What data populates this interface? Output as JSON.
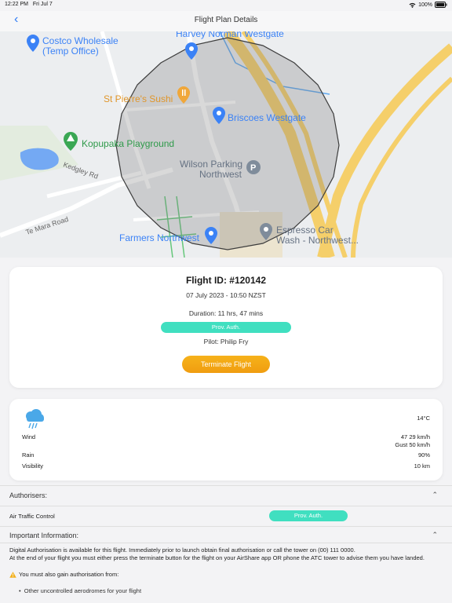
{
  "status_bar": {
    "time": "12:22 PM",
    "date": "Fri Jul 7",
    "battery": "100%"
  },
  "nav": {
    "back_icon": "chevron-left-icon",
    "title": "Flight Plan Details"
  },
  "map": {
    "labels": {
      "costco_1": "Costco Wholesale",
      "costco_2": "(Temp Office)",
      "harvey": "Harvey Norman Westgate",
      "sushi": "St Pierre's Sushi",
      "briscoes": "Briscoes Westgate",
      "kopupaka": "Kopupaka Playground",
      "kedgley": "Kedgley Rd",
      "wilson_1": "Wilson Parking",
      "wilson_2": "Northwest",
      "te_mara": "Te Mara Road",
      "farmers": "Farmers Northwest",
      "espresso_1": "Espresso Car",
      "espresso_2": "Wash - Northwest..."
    }
  },
  "flight": {
    "id": "Flight ID: #120142",
    "date": "07 July 2023 - 10:50 NZST",
    "duration": "Duration: 11 hrs, 47 mins",
    "status": "Prov. Auth.",
    "pilot": "Pilot: Philip Fry",
    "terminate_label": "Terminate Flight"
  },
  "weather": {
    "icon": "rain-cloud-icon",
    "temperature": "14°C",
    "wind_label": "Wind",
    "wind_speed": "47 29 km/h",
    "wind_gust": "Gust 50 km/h",
    "rain_label": "Rain",
    "rain_value": "90%",
    "visibility_label": "Visibility",
    "visibility_value": "10 km"
  },
  "authorisers": {
    "heading": "Authorisers:",
    "items": [
      {
        "name": "Air Traffic Control",
        "status": "Prov. Auth."
      }
    ]
  },
  "important": {
    "heading": "Important Information:",
    "paragraph_1": "Digital Authorisation is available for this flight. Immediately prior to launch obtain final authorisation or call the tower on (00) 111 0000.",
    "paragraph_2": "At the end of your flight you must either press the terminate button for the flight on your AirShare app OR phone the ATC tower to advise them you have landed.",
    "warning": "You must also gain authorisation from:",
    "bullets": [
      "Other uncontrolled aerodromes for your flight"
    ]
  },
  "colors": {
    "accent": "#2f7cf6",
    "badge": "#40dfc0",
    "terminate": "#f4a817"
  }
}
